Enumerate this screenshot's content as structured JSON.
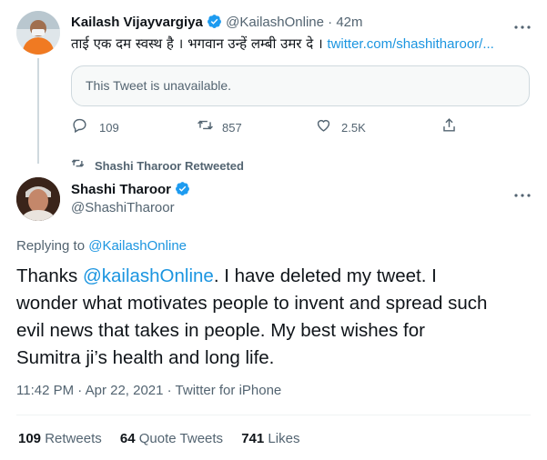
{
  "reply_tweet": {
    "author_name": "Kailash Vijayvargiya",
    "handle": "@KailashOnline",
    "separator": "·",
    "time_ago": "42m",
    "text": "ताई एक दम स्वस्थ है । भगवान उन्हें लम्बी उमर दे ।",
    "link_text": "twitter.com/shashitharoor/...",
    "quoted_unavailable": "This Tweet is unavailable.",
    "actions": {
      "replies": "109",
      "retweets": "857",
      "likes": "2.5K"
    }
  },
  "retweet_context": {
    "label": "Shashi Tharoor Retweeted"
  },
  "main_tweet": {
    "author_name": "Shashi Tharoor",
    "handle": "@ShashiTharoor",
    "replying_prefix": "Replying to",
    "replying_handle": "@KailashOnline",
    "text_before": "Thanks",
    "mention": "@kailashOnline",
    "text_after": ". I have deleted my tweet. I wonder what motivates people to invent and spread such evil news that takes in people. My best wishes for Sumitra ji’s health and long life.",
    "timestamp": "11:42 PM · Apr 22, 2021 · Twitter for iPhone",
    "stats": {
      "retweets_count": "109",
      "retweets_label": "Retweets",
      "quotes_count": "64",
      "quotes_label": "Quote Tweets",
      "likes_count": "741",
      "likes_label": "Likes"
    }
  },
  "colors": {
    "link": "#1b95e0",
    "verified": "#1d9bf0",
    "muted": "#536471",
    "border": "#cfd9de"
  }
}
